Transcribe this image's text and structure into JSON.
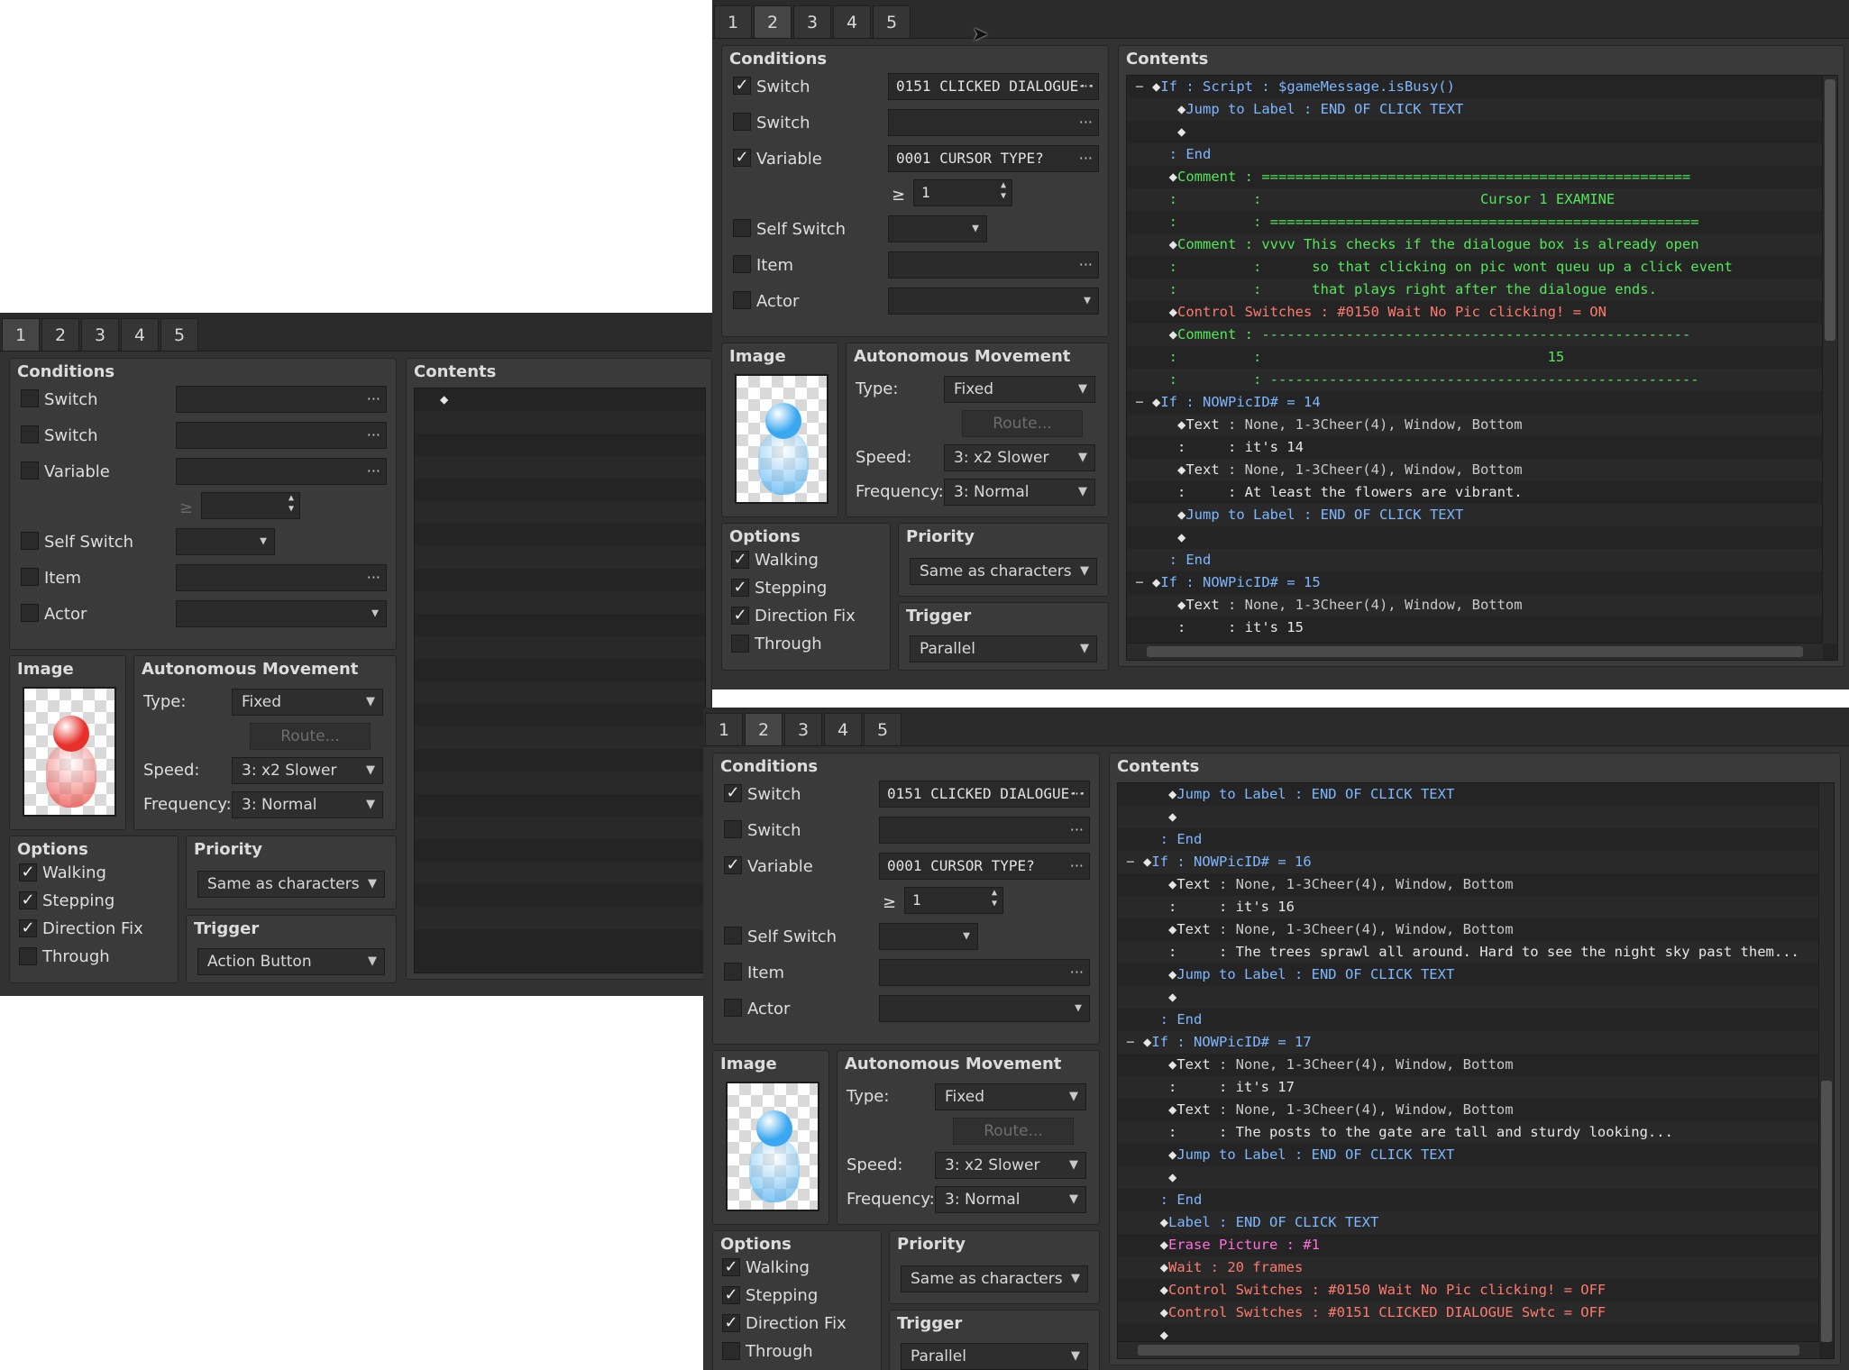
{
  "tabs": [
    "1",
    "2",
    "3",
    "4",
    "5"
  ],
  "labels": {
    "conditions": "Conditions",
    "switch": "Switch",
    "variable": "Variable",
    "self_switch": "Self Switch",
    "item": "Item",
    "actor": "Actor",
    "image": "Image",
    "autonomous_movement": "Autonomous Movement",
    "type": "Type:",
    "route": "Route...",
    "speed": "Speed:",
    "frequency": "Frequency:",
    "options": "Options",
    "walking": "Walking",
    "stepping": "Stepping",
    "direction_fix": "Direction Fix",
    "through": "Through",
    "priority": "Priority",
    "trigger": "Trigger",
    "contents": "Contents",
    "gte": "≥",
    "dots": "···",
    "dd": "▼"
  },
  "window_left": {
    "active_tab": 0,
    "switch1_value": "",
    "switch2_value": "",
    "variable_value": "",
    "variable_amount": "",
    "movement_type": "Fixed",
    "speed": "3: x2 Slower",
    "frequency": "3: Normal",
    "priority": "Same as characters",
    "trigger": "Action Button",
    "orb_color": "#e8302a",
    "contents": [
      {
        "parts": [
          {
            "t": "◆",
            "c": "c-white"
          }
        ]
      }
    ]
  },
  "window_top": {
    "active_tab": 1,
    "switch1_value": "0151 CLICKED DIALOGUE···",
    "switch2_value": "",
    "variable_value": "0001 CURSOR TYPE?",
    "variable_amount": "1",
    "movement_type": "Fixed",
    "speed": "3: x2 Slower",
    "frequency": "3: Normal",
    "priority": "Same as characters",
    "trigger": "Parallel",
    "orb_color": "#3aa8f0",
    "contents": [
      {
        "fold": "−",
        "parts": [
          {
            "t": "◆",
            "c": "c-white"
          },
          {
            "t": "If : Script : $gameMessage.isBusy()",
            "c": "c-blue"
          }
        ]
      },
      {
        "parts": [
          {
            "t": "   ◆",
            "c": "c-white"
          },
          {
            "t": "Jump to Label : END OF CLICK TEXT",
            "c": "c-blue"
          }
        ]
      },
      {
        "parts": [
          {
            "t": "   ◆",
            "c": "c-white"
          }
        ]
      },
      {
        "parts": [
          {
            "t": "  : End",
            "c": "c-blue"
          }
        ]
      },
      {
        "parts": [
          {
            "t": "  ◆",
            "c": "c-white"
          },
          {
            "t": "Comment : ===================================================",
            "c": "c-green"
          }
        ]
      },
      {
        "parts": [
          {
            "t": "  :         :                          Cursor 1 EXAMINE",
            "c": "c-green"
          }
        ]
      },
      {
        "parts": [
          {
            "t": "  :         : ===================================================",
            "c": "c-green"
          }
        ]
      },
      {
        "parts": [
          {
            "t": "  ◆",
            "c": "c-white"
          },
          {
            "t": "Comment : vvvv This checks if the dialogue box is already open",
            "c": "c-green"
          }
        ]
      },
      {
        "parts": [
          {
            "t": "  :         :      so that clicking on pic wont queu up a click event",
            "c": "c-green"
          }
        ]
      },
      {
        "parts": [
          {
            "t": "  :         :      that plays right after the dialogue ends.",
            "c": "c-green"
          }
        ]
      },
      {
        "parts": [
          {
            "t": "  ◆",
            "c": "c-white"
          },
          {
            "t": "Control Switches : #0150 Wait No Pic clicking! = ON",
            "c": "c-red"
          }
        ]
      },
      {
        "parts": [
          {
            "t": "  ◆",
            "c": "c-white"
          },
          {
            "t": "Comment : ---------------------------------------------------",
            "c": "c-green"
          }
        ]
      },
      {
        "parts": [
          {
            "t": "  :         :                                  15",
            "c": "c-green"
          }
        ]
      },
      {
        "parts": [
          {
            "t": "  :         : ---------------------------------------------------",
            "c": "c-green"
          }
        ]
      },
      {
        "fold": "−",
        "parts": [
          {
            "t": "◆",
            "c": "c-white"
          },
          {
            "t": "If : NOWPicID# = 14",
            "c": "c-blue"
          }
        ]
      },
      {
        "parts": [
          {
            "t": "   ◆",
            "c": "c-white"
          },
          {
            "t": "Text",
            "c": "c-white"
          },
          {
            "t": " : None, 1-3Cheer(4), Window, Bottom",
            "c": "c-gray"
          }
        ]
      },
      {
        "parts": [
          {
            "t": "   :     : it's 14",
            "c": "c-white"
          }
        ]
      },
      {
        "parts": [
          {
            "t": "   ◆",
            "c": "c-white"
          },
          {
            "t": "Text",
            "c": "c-white"
          },
          {
            "t": " : None, 1-3Cheer(4), Window, Bottom",
            "c": "c-gray"
          }
        ]
      },
      {
        "parts": [
          {
            "t": "   :     : At least the flowers are vibrant.",
            "c": "c-white"
          }
        ]
      },
      {
        "parts": [
          {
            "t": "   ◆",
            "c": "c-white"
          },
          {
            "t": "Jump to Label : END OF CLICK TEXT",
            "c": "c-blue"
          }
        ]
      },
      {
        "parts": [
          {
            "t": "   ◆",
            "c": "c-white"
          }
        ]
      },
      {
        "parts": [
          {
            "t": "  : End",
            "c": "c-blue"
          }
        ]
      },
      {
        "fold": "−",
        "parts": [
          {
            "t": "◆",
            "c": "c-white"
          },
          {
            "t": "If : NOWPicID# = 15",
            "c": "c-blue"
          }
        ]
      },
      {
        "parts": [
          {
            "t": "   ◆",
            "c": "c-white"
          },
          {
            "t": "Text",
            "c": "c-white"
          },
          {
            "t": " : None, 1-3Cheer(4), Window, Bottom",
            "c": "c-gray"
          }
        ]
      },
      {
        "parts": [
          {
            "t": "   :     : it's 15",
            "c": "c-white"
          }
        ]
      }
    ]
  },
  "window_bottom": {
    "active_tab": 1,
    "switch1_value": "0151 CLICKED DIALOGUE···",
    "switch2_value": "",
    "variable_value": "0001 CURSOR TYPE?",
    "variable_amount": "1",
    "movement_type": "Fixed",
    "speed": "3: x2 Slower",
    "frequency": "3: Normal",
    "priority": "Same as characters",
    "trigger": "Parallel",
    "orb_color": "#3aa8f0",
    "contents": [
      {
        "parts": [
          {
            "t": "   ◆",
            "c": "c-white"
          },
          {
            "t": "Jump to Label : END OF CLICK TEXT",
            "c": "c-blue"
          }
        ]
      },
      {
        "parts": [
          {
            "t": "   ◆",
            "c": "c-white"
          }
        ]
      },
      {
        "parts": [
          {
            "t": "  : End",
            "c": "c-blue"
          }
        ]
      },
      {
        "fold": "−",
        "parts": [
          {
            "t": "◆",
            "c": "c-white"
          },
          {
            "t": "If : NOWPicID# = 16",
            "c": "c-blue"
          }
        ]
      },
      {
        "parts": [
          {
            "t": "   ◆",
            "c": "c-white"
          },
          {
            "t": "Text",
            "c": "c-white"
          },
          {
            "t": " : None, 1-3Cheer(4), Window, Bottom",
            "c": "c-gray"
          }
        ]
      },
      {
        "parts": [
          {
            "t": "   :     : it's 16",
            "c": "c-white"
          }
        ]
      },
      {
        "parts": [
          {
            "t": "   ◆",
            "c": "c-white"
          },
          {
            "t": "Text",
            "c": "c-white"
          },
          {
            "t": " : None, 1-3Cheer(4), Window, Bottom",
            "c": "c-gray"
          }
        ]
      },
      {
        "parts": [
          {
            "t": "   :     : The trees sprawl all around. Hard to see the night sky past them...",
            "c": "c-white"
          }
        ]
      },
      {
        "parts": [
          {
            "t": "   ◆",
            "c": "c-white"
          },
          {
            "t": "Jump to Label : END OF CLICK TEXT",
            "c": "c-blue"
          }
        ]
      },
      {
        "parts": [
          {
            "t": "   ◆",
            "c": "c-white"
          }
        ]
      },
      {
        "parts": [
          {
            "t": "  : End",
            "c": "c-blue"
          }
        ]
      },
      {
        "fold": "−",
        "parts": [
          {
            "t": "◆",
            "c": "c-white"
          },
          {
            "t": "If : NOWPicID# = 17",
            "c": "c-blue"
          }
        ]
      },
      {
        "parts": [
          {
            "t": "   ◆",
            "c": "c-white"
          },
          {
            "t": "Text",
            "c": "c-white"
          },
          {
            "t": " : None, 1-3Cheer(4), Window, Bottom",
            "c": "c-gray"
          }
        ]
      },
      {
        "parts": [
          {
            "t": "   :     : it's 17",
            "c": "c-white"
          }
        ]
      },
      {
        "parts": [
          {
            "t": "   ◆",
            "c": "c-white"
          },
          {
            "t": "Text",
            "c": "c-white"
          },
          {
            "t": " : None, 1-3Cheer(4), Window, Bottom",
            "c": "c-gray"
          }
        ]
      },
      {
        "parts": [
          {
            "t": "   :     : The posts to the gate are tall and sturdy looking...",
            "c": "c-white"
          }
        ]
      },
      {
        "parts": [
          {
            "t": "   ◆",
            "c": "c-white"
          },
          {
            "t": "Jump to Label : END OF CLICK TEXT",
            "c": "c-blue"
          }
        ]
      },
      {
        "parts": [
          {
            "t": "   ◆",
            "c": "c-white"
          }
        ]
      },
      {
        "parts": [
          {
            "t": "  : End",
            "c": "c-blue"
          }
        ]
      },
      {
        "parts": [
          {
            "t": "  ◆",
            "c": "c-white"
          },
          {
            "t": "Label : END OF CLICK TEXT",
            "c": "c-blue"
          }
        ]
      },
      {
        "parts": [
          {
            "t": "  ◆",
            "c": "c-white"
          },
          {
            "t": "Erase Picture : #1",
            "c": "c-pink"
          }
        ]
      },
      {
        "parts": [
          {
            "t": "  ◆",
            "c": "c-white"
          },
          {
            "t": "Wait : 20 frames",
            "c": "c-red"
          }
        ]
      },
      {
        "parts": [
          {
            "t": "  ◆",
            "c": "c-white"
          },
          {
            "t": "Control Switches : #0150 Wait No Pic clicking! = OFF",
            "c": "c-red"
          }
        ]
      },
      {
        "parts": [
          {
            "t": "  ◆",
            "c": "c-white"
          },
          {
            "t": "Control Switches : #0151 CLICKED DIALOGUE Swtc = OFF",
            "c": "c-red"
          }
        ]
      },
      {
        "parts": [
          {
            "t": "  ◆",
            "c": "c-white"
          }
        ]
      }
    ]
  }
}
